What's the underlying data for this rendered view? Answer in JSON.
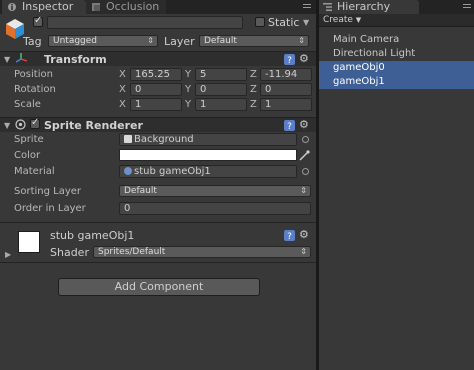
{
  "inspector_tabs": [
    {
      "label": "Inspector",
      "icon": "inspector-icon"
    },
    {
      "label": "Occlusion",
      "icon": "occlusion-icon"
    }
  ],
  "object": {
    "name": "",
    "static_label": "Static",
    "tag_label": "Tag",
    "tag_value": "Untagged",
    "layer_label": "Layer",
    "layer_value": "Default"
  },
  "transform": {
    "title": "Transform",
    "position_label": "Position",
    "rotation_label": "Rotation",
    "scale_label": "Scale",
    "axes": [
      "X",
      "Y",
      "Z"
    ],
    "position": [
      "165.25",
      "5",
      "-11.94"
    ],
    "rotation": [
      "0",
      "0",
      "0"
    ],
    "scale": [
      "1",
      "1",
      "1"
    ]
  },
  "sprite_renderer": {
    "title": "Sprite Renderer",
    "sprite_label": "Sprite",
    "sprite_value": "Background",
    "color_label": "Color",
    "color_value": "#ffffff",
    "material_label": "Material",
    "material_value": "stub gameObj1",
    "sorting_layer_label": "Sorting Layer",
    "sorting_layer_value": "Default",
    "order_label": "Order in Layer",
    "order_value": "0"
  },
  "material": {
    "name": "stub gameObj1",
    "shader_label": "Shader",
    "shader_value": "Sprites/Default"
  },
  "add_component_label": "Add Component",
  "hierarchy": {
    "tab_label": "Hierarchy",
    "create_label": "Create",
    "items": [
      {
        "label": "Main Camera",
        "selected": false
      },
      {
        "label": "Directional Light",
        "selected": false
      },
      {
        "label": "gameObj0",
        "selected": true
      },
      {
        "label": "gameObj1",
        "selected": true
      }
    ]
  },
  "colors": {
    "selection": "#3e5f96",
    "panel": "#383838",
    "header": "#2e2e2e"
  }
}
